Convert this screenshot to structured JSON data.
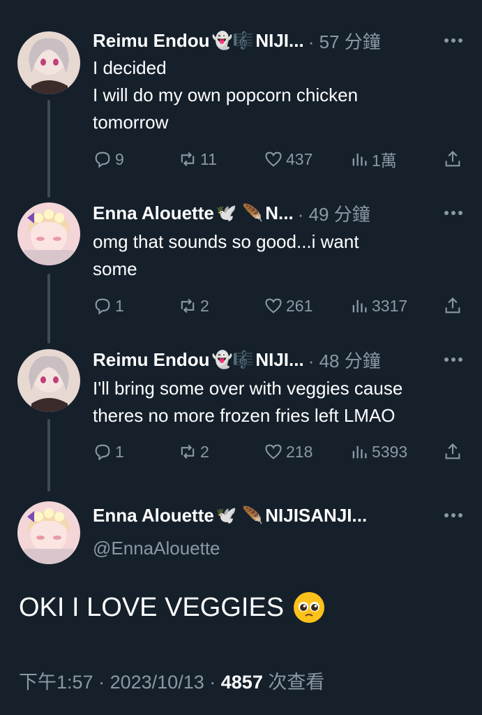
{
  "tweets": [
    {
      "name": "Reimu Endou",
      "name_emoji": "👻🎼",
      "handle_trunc": "NIJI...",
      "time": "· 57 分鐘",
      "lines": [
        "I decided",
        "I will do my own popcorn chicken",
        "tomorrow"
      ],
      "replies": "9",
      "retweets": "11",
      "likes": "437",
      "views": "1萬"
    },
    {
      "name": "Enna Alouette",
      "name_emoji": "🕊️ 🪶",
      "handle_trunc": "N...",
      "time": "· 49 分鐘",
      "lines": [
        "omg that sounds so good...i want",
        "some"
      ],
      "replies": "1",
      "retweets": "2",
      "likes": "261",
      "views": "3317"
    },
    {
      "name": "Reimu Endou",
      "name_emoji": "👻🎼",
      "handle_trunc": "NIJI...",
      "time": "· 48 分鐘",
      "lines": [
        "I'll bring some over with veggies cause",
        "theres no more frozen fries left LMAO"
      ],
      "replies": "1",
      "retweets": "2",
      "likes": "218",
      "views": "5393"
    }
  ],
  "focus": {
    "name": "Enna Alouette",
    "name_emoji": "🕊️ 🪶",
    "handle_trunc": "NIJISANJI...",
    "handle": "@EnnaAlouette",
    "text": "OKI I LOVE VEGGIES",
    "emoji_name": "pleading-face",
    "time": "下午1:57",
    "date": "2023/10/13",
    "views_count": "4857",
    "views_label": "次查看",
    "sep": "·"
  },
  "colors": {
    "background": "#15202b",
    "muted": "#8b98a5",
    "thread_line": "#3d4b58"
  }
}
